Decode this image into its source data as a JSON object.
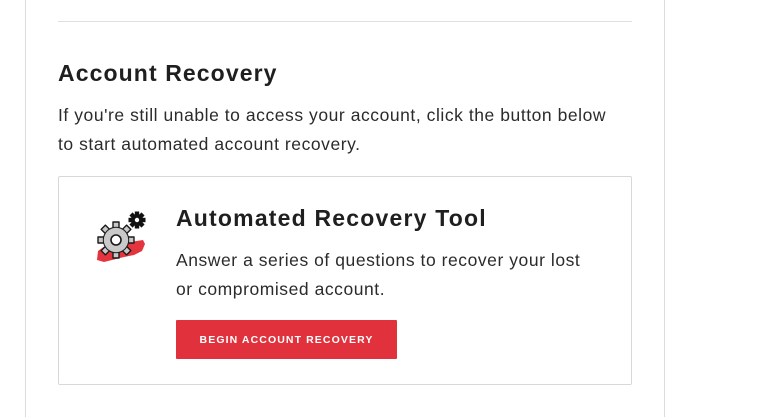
{
  "section": {
    "title": "Account Recovery",
    "description": "If you're still unable to access your account, click the button below to start automated account recovery."
  },
  "tool": {
    "title": "Automated Recovery Tool",
    "description": "Answer a series of questions to recover your lost or compromised account.",
    "button_label": "BEGIN ACCOUNT RECOVERY",
    "icon": "gears-icon"
  },
  "colors": {
    "accent": "#e0313c",
    "text": "#222222",
    "border": "#d8d8d8"
  }
}
